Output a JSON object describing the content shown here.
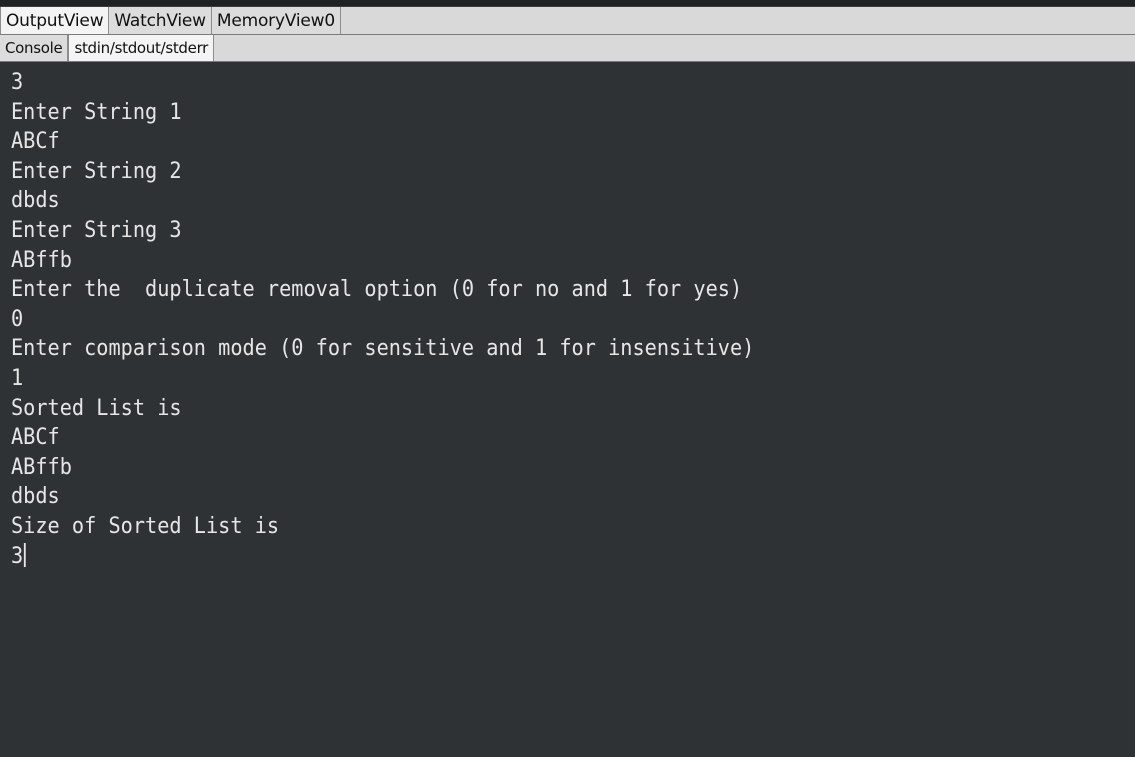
{
  "tabs": {
    "primary": [
      {
        "label": "OutputView",
        "active": true
      },
      {
        "label": "WatchView",
        "active": false
      },
      {
        "label": "MemoryView0",
        "active": false
      }
    ],
    "secondary": [
      {
        "label": "Console",
        "active": false
      },
      {
        "label": "stdin/stdout/stderr",
        "active": true
      }
    ]
  },
  "console": {
    "lines": [
      "3",
      "Enter String 1",
      "ABCf",
      "Enter String 2",
      "dbds",
      "Enter String 3",
      "ABffb",
      "Enter the  duplicate removal option (0 for no and 1 for yes)",
      "0",
      "Enter comparison mode (0 for sensitive and 1 for insensitive)",
      "1",
      "Sorted List is",
      "ABCf",
      "ABffb",
      "dbds",
      "Size of Sorted List is",
      "3"
    ]
  },
  "colors": {
    "background": "#2f3235",
    "text": "#e6e6e6",
    "tab_bg": "#e3e3e3"
  }
}
